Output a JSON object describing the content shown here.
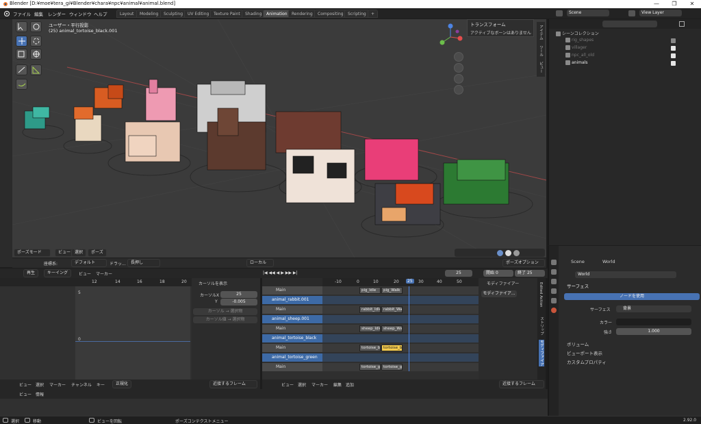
{
  "window": {
    "title": "Blender [D:¥moe¥tera_gi¥Blender¥chara¥npc¥animal¥animal.blend]",
    "minimize": "—",
    "maximize": "❐",
    "close": "✕"
  },
  "menubar": {
    "menus": [
      "ファイル",
      "編集",
      "レンダー",
      "ウィンドウ",
      "ヘルプ"
    ],
    "workspaces": [
      "Layout",
      "Modeling",
      "Sculpting",
      "UV Editing",
      "Texture Paint",
      "Shading",
      "Animation",
      "Rendering",
      "Compositing",
      "Scripting"
    ],
    "active_workspace": "Animation",
    "add_tab": "+",
    "scene_name": "Scene",
    "view_layer": "View Layer"
  },
  "viewport": {
    "view_label": "ユーザー・平行投影",
    "object_label": "(25) animal_tortoise_black.001",
    "transform_panel_title": "トランスフォーム",
    "transform_panel_msg": "アクティブなボーンはありません",
    "side_tabs": [
      "アイテム",
      "ツール",
      "ビュー"
    ],
    "mode": "ポーズモード",
    "header_menus": [
      "ビュー",
      "選択",
      "ポーズ"
    ],
    "coord_label": "座標系:",
    "coord_value": "デフォルト",
    "drag_label": "ドラッ...",
    "drag_value": "長押し",
    "pivot_value": "ローカル",
    "pose_options": "ポーズオプション"
  },
  "timeline": {
    "playback": "再生",
    "keying": "キーイング",
    "menus": [
      "ビュー",
      "マーカー"
    ],
    "current_frame": "25",
    "start_label": "開始",
    "start": "0",
    "end_label": "終了",
    "end": "25"
  },
  "graph": {
    "ruler": [
      "12",
      "14",
      "16",
      "18",
      "20"
    ],
    "y_marks": [
      "5",
      "0"
    ],
    "cursor_panel_title": "カーソルを表示",
    "cursor_x_label": "カーソルX",
    "cursor_x": "25",
    "cursor_y_label": "Y",
    "cursor_y": "-0.005",
    "btn_cursor_to_sel": "カーソル → 選択物",
    "btn_val_to_sel": "カーソル値 → 選択物",
    "footer_menus": [
      "ビュー",
      "選択",
      "マーカー",
      "チャンネル",
      "キー"
    ],
    "normalize": "正規化",
    "nearest_frame": "近接するフレーム"
  },
  "nla": {
    "ruler": [
      "-10",
      "0",
      "10",
      "20",
      "25",
      "30",
      "40",
      "50"
    ],
    "modifier_panel_title": "モディファイアー",
    "add_modifier": "モディファイア...",
    "side_tabs": [
      "モディファイア",
      "ストリップ",
      "Edited Action"
    ],
    "tracks": [
      {
        "name": "Main",
        "type": "sub",
        "strips": []
      },
      {
        "name": "animal_rabbit.001",
        "type": "obj",
        "strips": []
      },
      {
        "name": "Main",
        "type": "sub",
        "strips": [
          "rabbit_Idle",
          "rabbit_Walk"
        ]
      },
      {
        "name": "animal_sheep.001",
        "type": "obj",
        "strips": []
      },
      {
        "name": "Main",
        "type": "sub",
        "strips": [
          "sheep_Idle",
          "sheep_Walk"
        ]
      },
      {
        "name": "animal_tortoise_black",
        "type": "obj",
        "strips": []
      },
      {
        "name": "Main",
        "type": "sub",
        "strips": [
          "tortoise_b",
          "tortoise_b"
        ]
      },
      {
        "name": "animal_tortoise_green",
        "type": "obj",
        "strips": []
      },
      {
        "name": "Main",
        "type": "sub",
        "strips": [
          "tortoise_g",
          "tortoise_g"
        ]
      }
    ],
    "top_strips": [
      "pig_Idle",
      "pig_Walk"
    ],
    "footer_menus": [
      "ビュー",
      "選択",
      "マーカー",
      "編集",
      "追加"
    ],
    "nearest_frame": "近接するフレーム"
  },
  "info": {
    "menus": [
      "ビュー",
      "情報"
    ]
  },
  "outliner": {
    "root": "シーンコレクション",
    "items": [
      {
        "name": "rig_shapes",
        "dim": true
      },
      {
        "name": "villager",
        "dim": true
      },
      {
        "name": "npc_all_old",
        "dim": true
      },
      {
        "name": "animals",
        "dim": false
      }
    ]
  },
  "properties": {
    "breadcrumb_scene": "Scene",
    "breadcrumb_world": "World",
    "world_name": "World",
    "surface_section": "サーフェス",
    "use_nodes": "ノードを使用",
    "surface_label": "サーフェス",
    "surface_value": "背景",
    "color_label": "カラー",
    "strength_label": "強さ",
    "strength_value": "1.000",
    "sections": [
      "ボリューム",
      "ビューポート表示",
      "カスタムプロパティ"
    ]
  },
  "statusbar": {
    "select": "選択",
    "move": "移動",
    "rotate_view": "ビューを回転",
    "context_menu": "ポーズコンテクストメニュー",
    "version": "2.92.0"
  }
}
